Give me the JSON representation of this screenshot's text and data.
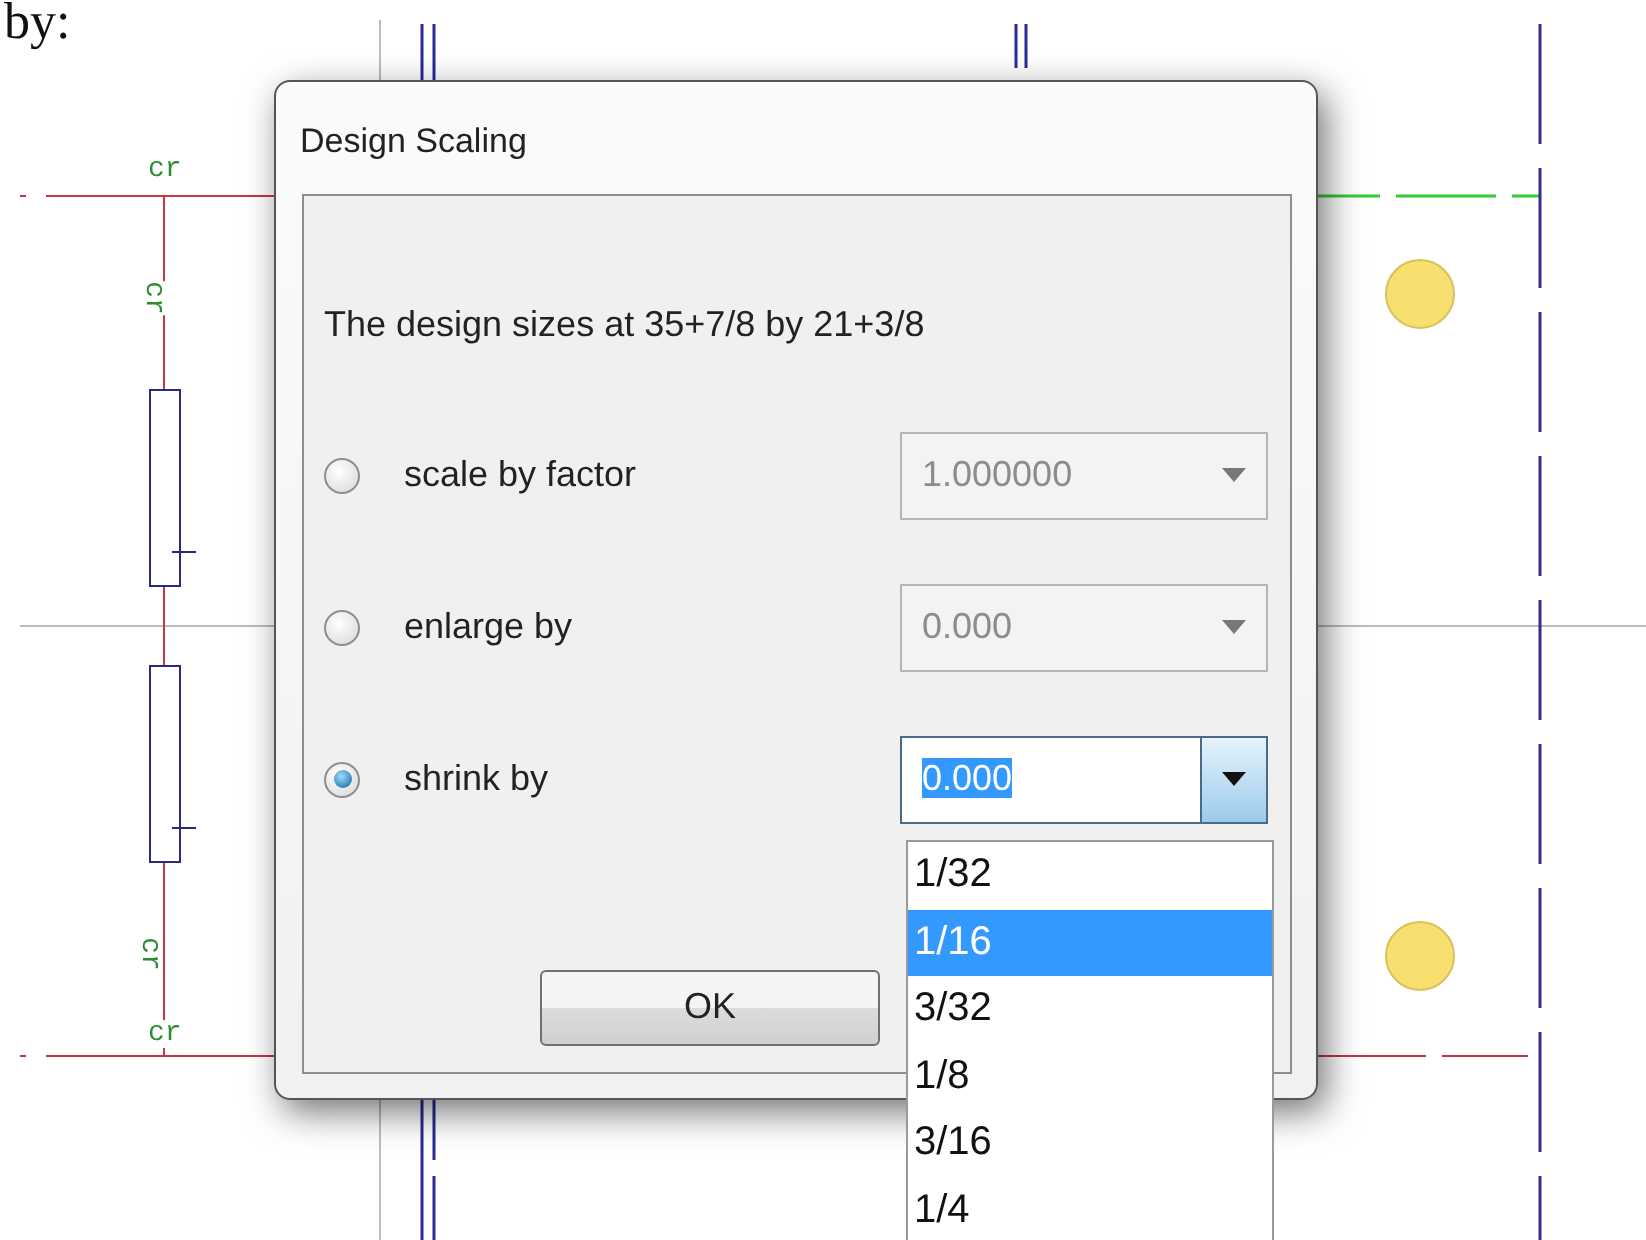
{
  "page": {
    "caption": "by:"
  },
  "canvas": {
    "labels": [
      {
        "text": "cr",
        "vertical": false
      },
      {
        "text": "cr",
        "vertical": true
      },
      {
        "text": "cr",
        "vertical": true
      },
      {
        "text": "cr",
        "vertical": false
      }
    ]
  },
  "dialog": {
    "title": "Design Scaling",
    "message": "The design sizes at 35+7/8 by 21+3/8",
    "options": [
      {
        "label": "scale by factor",
        "selected": false,
        "value": "1.000000",
        "disabled": true,
        "focused": false
      },
      {
        "label": "enlarge by",
        "selected": false,
        "value": "0.000",
        "disabled": true,
        "focused": false
      },
      {
        "label": "shrink by",
        "selected": true,
        "value": "0.000",
        "disabled": false,
        "focused": true
      }
    ],
    "dropdown": {
      "items": [
        {
          "label": "1/32",
          "selected": false
        },
        {
          "label": "1/16",
          "selected": true
        },
        {
          "label": "3/32",
          "selected": false
        },
        {
          "label": "1/8",
          "selected": false
        },
        {
          "label": "3/16",
          "selected": false
        },
        {
          "label": "1/4",
          "selected": false
        }
      ]
    },
    "buttons": [
      "OK"
    ]
  }
}
